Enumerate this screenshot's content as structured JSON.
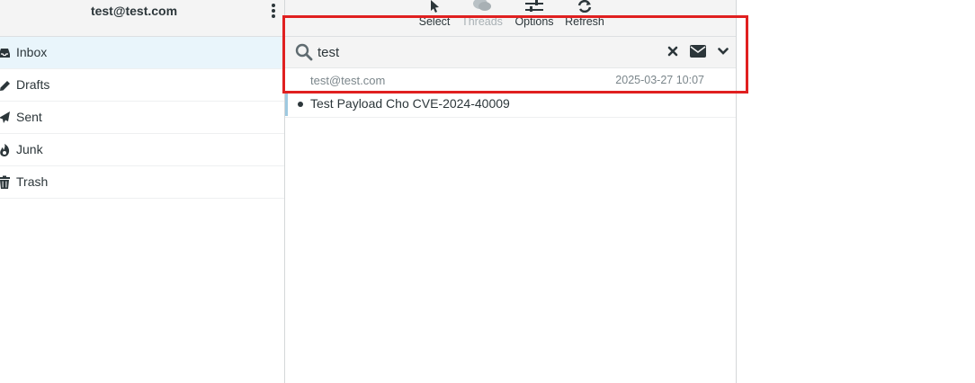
{
  "account": {
    "email": "test@test.com"
  },
  "folders": [
    {
      "label": "Inbox",
      "icon": "inbox-icon",
      "selected": true
    },
    {
      "label": "Drafts",
      "icon": "pencil-icon"
    },
    {
      "label": "Sent",
      "icon": "paper-plane-icon"
    },
    {
      "label": "Junk",
      "icon": "fire-icon"
    },
    {
      "label": "Trash",
      "icon": "trash-icon"
    }
  ],
  "toolbar": {
    "select_label": "Select",
    "threads_label": "Threads",
    "options_label": "Options",
    "refresh_label": "Refresh"
  },
  "search": {
    "value": "test"
  },
  "messages": [
    {
      "from": "test@test.com",
      "date": "2025-03-27 10:07",
      "subject": "Test Payload Cho CVE-2024-40009",
      "unread": true
    }
  ],
  "colors": {
    "selected_folder_bg": "#e9f5fb",
    "annotation_red": "#e02020",
    "text": "#2c363a",
    "muted": "#7b868b"
  }
}
